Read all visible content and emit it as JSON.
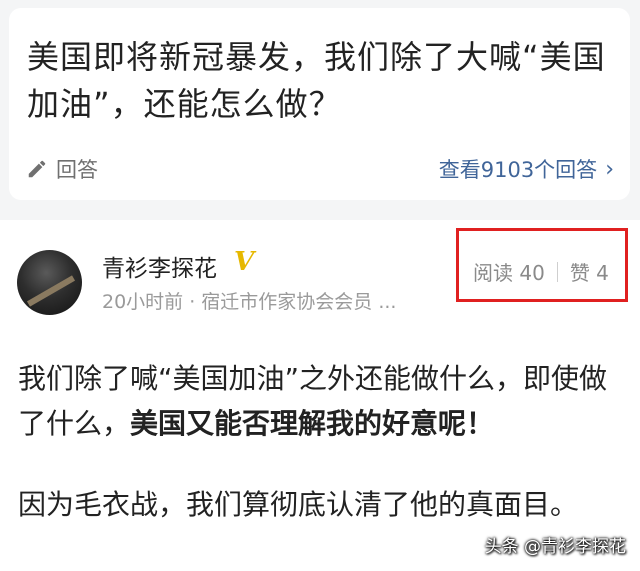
{
  "question": {
    "title": "美国即将新冠暴发，我们除了大喊“美国加油”，还能怎么做？",
    "answer_label": "回答",
    "view_answers_label": "查看9103个回答",
    "icons": {
      "answer": "pencil-icon",
      "view": "chevron-right-icon"
    }
  },
  "author": {
    "name": "青衫李探花",
    "badge": "V",
    "meta": "20小时前 · 宿迁市作家协会会员 ..."
  },
  "stats": {
    "reads": "阅读 40",
    "likes": "赞 4"
  },
  "content": {
    "para1_text": "我们除了喊“美国加油”之外还能做什么，即使做了什么，",
    "para1_bold": "美国又能否理解我的好意呢！",
    "para2": "因为毛衣战，我们算彻底认清了他的真面目。"
  },
  "watermark": "头条 @青衫李探花",
  "colors": {
    "link": "#406599",
    "highlight_box": "#e02020",
    "badge": "#e6b800"
  }
}
